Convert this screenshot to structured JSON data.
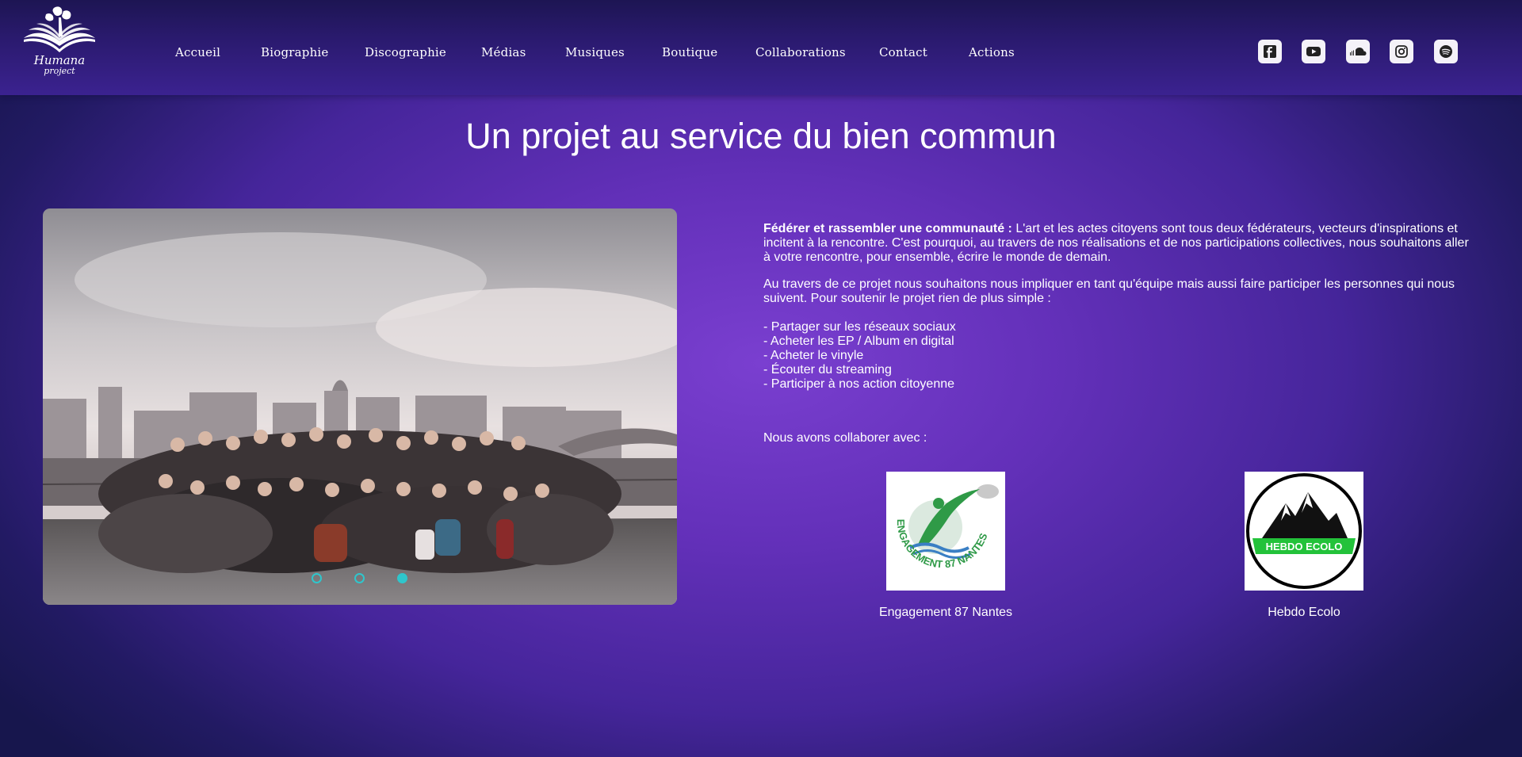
{
  "brand": {
    "line1": "Humana",
    "line2": "project"
  },
  "nav": [
    {
      "label": "Accueil"
    },
    {
      "label": "Biographie"
    },
    {
      "label": "Discographie"
    },
    {
      "label": "Médias"
    },
    {
      "label": "Musiques"
    },
    {
      "label": "Boutique"
    },
    {
      "label": "Collaborations"
    },
    {
      "label": "Contact"
    },
    {
      "label": "Actions"
    }
  ],
  "social": [
    "facebook-icon",
    "youtube-icon",
    "soundcloud-icon",
    "instagram-icon",
    "spotify-icon"
  ],
  "headline": "Un projet au service du bien commun",
  "slider": {
    "slides": 3,
    "active_index": 3
  },
  "intro": {
    "bold": "Fédérer et rassembler une communauté :",
    "text": " L'art et les actes citoyens sont tous deux fédérateurs, vecteurs d'inspirations et incitent à la rencontre. C'est pourquoi, au travers de nos réalisations et de nos participations collectives, nous souhaitons aller à votre rencontre, pour ensemble, écrire le monde de demain."
  },
  "support": "Au travers de ce projet nous souhaitons nous impliquer en tant qu'équipe mais aussi faire participer les personnes qui nous suivent. Pour soutenir le projet rien de plus simple :",
  "support_list": [
    "- Partager sur les réseaux sociaux",
    "- Acheter les EP / Album en digital",
    "- Acheter le vinyle",
    "- Écouter du streaming",
    "- Participer à nos action citoyenne"
  ],
  "collab_title": "Nous avons collaborer avec :",
  "partners": [
    {
      "name": "Engagement 87 Nantes",
      "logo_text": "ENGAGEMENT 87 NANTES"
    },
    {
      "name": "Hebdo Ecolo",
      "logo_text": "HEBDO ECOLO"
    }
  ],
  "colors": {
    "accent_cyan": "#2fc6cc",
    "nav_bg": "#2a1a6e",
    "bg_center": "#7a3fd0",
    "bg_edge": "#17164d"
  }
}
